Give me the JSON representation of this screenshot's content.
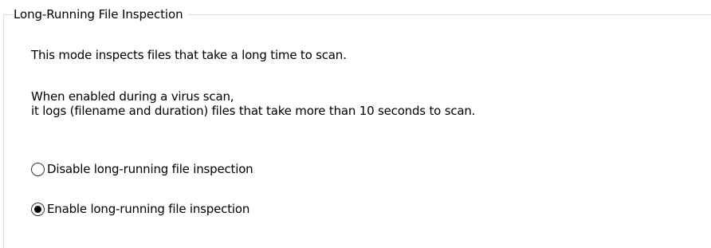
{
  "group": {
    "title": "Long-Running File Inspection"
  },
  "description": {
    "line1": "This mode inspects files that take a long time to scan.",
    "line2": "When enabled during a virus scan,",
    "line3": "it logs (filename and duration) files that take more than 10 seconds to scan."
  },
  "options": [
    {
      "label": "Disable long-running file inspection",
      "selected": false
    },
    {
      "label": "Enable long-running file inspection",
      "selected": true
    }
  ],
  "colors": {
    "groupbox_border": "#d5dfe5",
    "text": "#000000"
  }
}
